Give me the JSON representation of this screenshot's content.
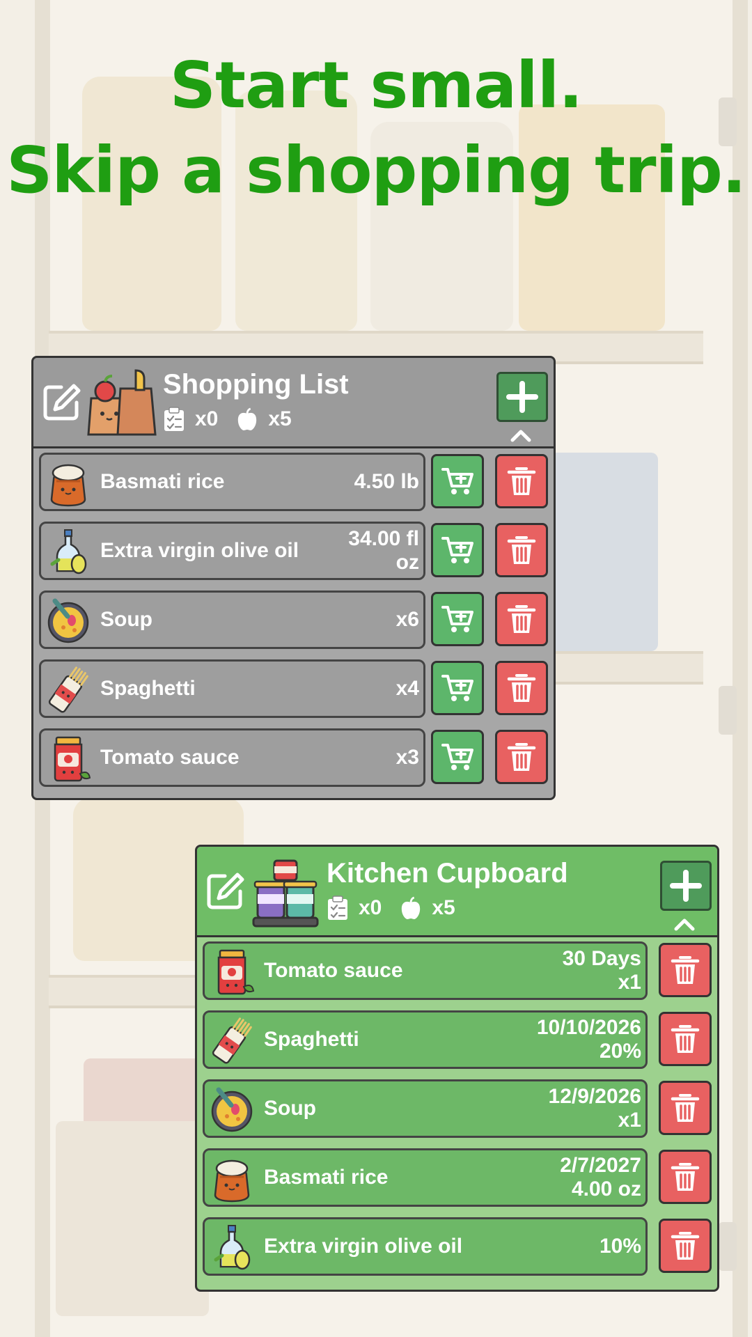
{
  "headline": {
    "line1": "Start small.",
    "line2": "Skip a shopping trip."
  },
  "colors": {
    "headline": "#1f9e12",
    "shopping_panel": "#a7a7a7",
    "cupboard_panel": "#9dd18e",
    "add_to_cart": "#5db66b",
    "delete": "#e86161"
  },
  "shopping_list": {
    "title": "Shopping List",
    "checklist_count": "x0",
    "item_count": "x5",
    "items": [
      {
        "name": "Basmati rice",
        "qty_line1": "4.50 lb",
        "qty_line2": "",
        "icon": "rice-sack-icon"
      },
      {
        "name": "Extra virgin olive oil",
        "qty_line1": "34.00 fl",
        "qty_line2": "oz",
        "icon": "olive-oil-icon"
      },
      {
        "name": "Soup",
        "qty_line1": "x6",
        "qty_line2": "",
        "icon": "soup-bowl-icon"
      },
      {
        "name": "Spaghetti",
        "qty_line1": "x4",
        "qty_line2": "",
        "icon": "spaghetti-icon"
      },
      {
        "name": "Tomato sauce",
        "qty_line1": "x3",
        "qty_line2": "",
        "icon": "tomato-sauce-jar-icon"
      }
    ]
  },
  "kitchen_cupboard": {
    "title": "Kitchen Cupboard",
    "checklist_count": "x0",
    "item_count": "x5",
    "items": [
      {
        "name": "Tomato sauce",
        "qty_line1": "30 Days",
        "qty_line2": "x1",
        "icon": "tomato-sauce-jar-icon"
      },
      {
        "name": "Spaghetti",
        "qty_line1": "10/10/2026",
        "qty_line2": "20%",
        "icon": "spaghetti-icon"
      },
      {
        "name": "Soup",
        "qty_line1": "12/9/2026",
        "qty_line2": "x1",
        "icon": "soup-bowl-icon"
      },
      {
        "name": "Basmati rice",
        "qty_line1": "2/7/2027",
        "qty_line2": "4.00 oz",
        "icon": "rice-sack-icon"
      },
      {
        "name": "Extra virgin olive oil",
        "qty_line1": "10%",
        "qty_line2": "",
        "icon": "olive-oil-icon"
      }
    ]
  }
}
